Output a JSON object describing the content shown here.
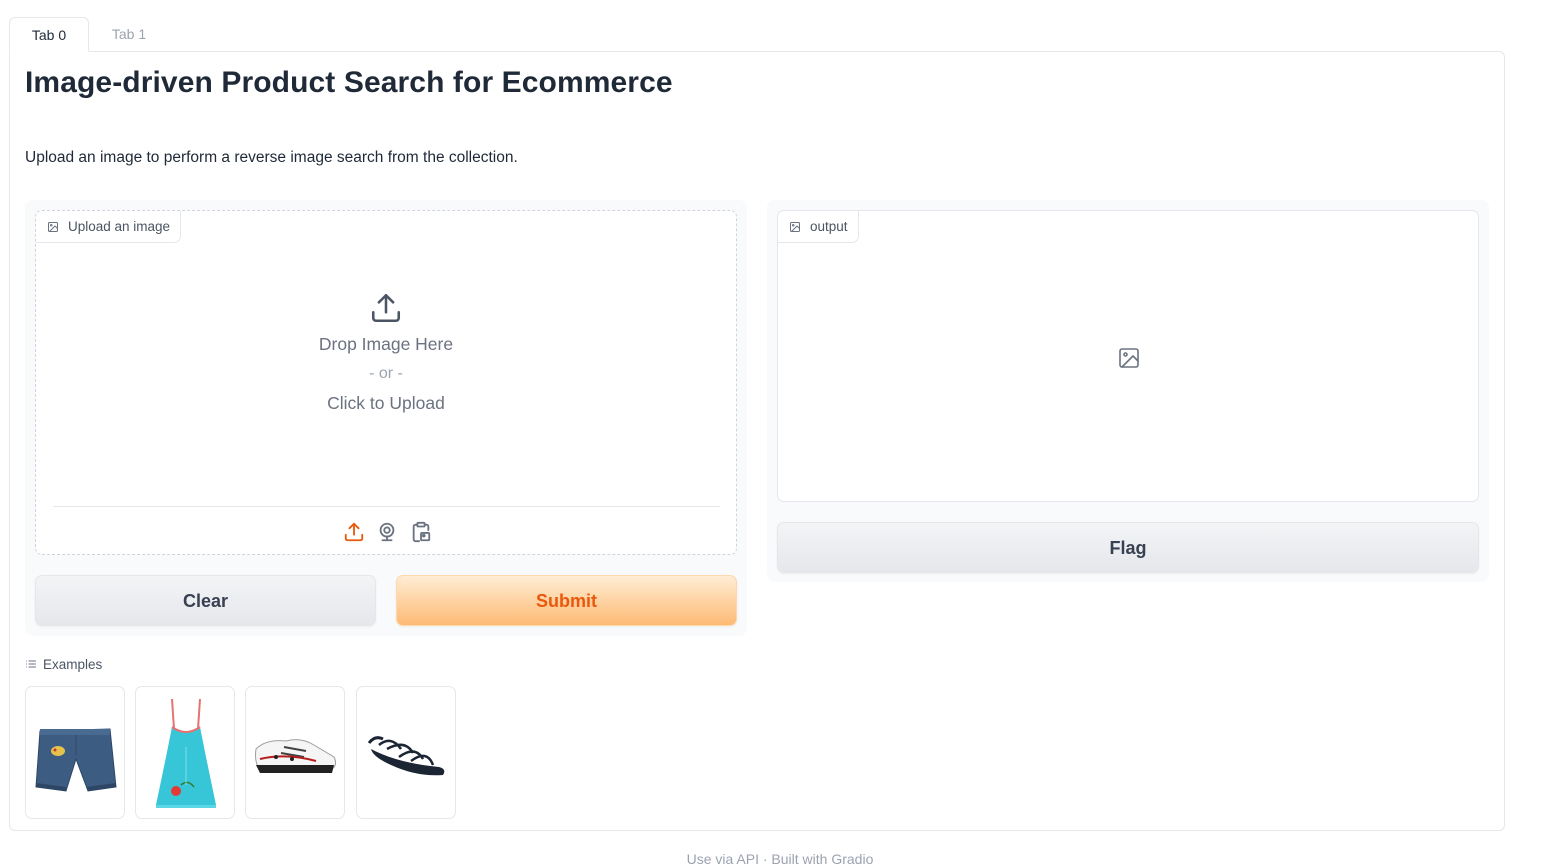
{
  "tabs": [
    {
      "label": "Tab 0",
      "active": true
    },
    {
      "label": "Tab 1",
      "active": false
    }
  ],
  "header": {
    "title": "Image-driven Product Search for Ecommerce",
    "description": "Upload an image to perform a reverse image search from the collection."
  },
  "input_image": {
    "label": "Upload an image",
    "drop_text": "Drop Image Here",
    "or_text": "- or -",
    "click_text": "Click to Upload",
    "sources": [
      "upload-icon",
      "webcam-icon",
      "clipboard-icon"
    ]
  },
  "output_image": {
    "label": "output",
    "placeholder_icon": "image-icon"
  },
  "buttons": {
    "clear": "Clear",
    "submit": "Submit",
    "flag": "Flag"
  },
  "examples": {
    "label": "Examples",
    "items": [
      {
        "name": "denim-shorts-example"
      },
      {
        "name": "turquoise-dress-example"
      },
      {
        "name": "white-sneaker-example"
      },
      {
        "name": "black-sandal-example"
      }
    ]
  },
  "footer": {
    "text": "Use via API  ·  Built with Gradio"
  },
  "colors": {
    "accent": "#ea580c",
    "accent_bg": "#fdba74",
    "border": "#e5e7eb"
  }
}
